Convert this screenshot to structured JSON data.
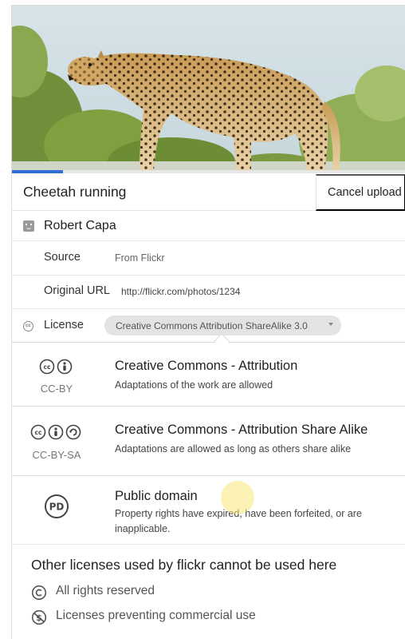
{
  "photo": {
    "title": "Cheetah running",
    "upload_progress_percent": 13
  },
  "header": {
    "cancel_label": "Cancel upload"
  },
  "author": {
    "name": "Robert Capa",
    "icon": "avatar-icon"
  },
  "fields": {
    "source_label": "Source",
    "source_value": "From Flickr",
    "url_label": "Original URL",
    "url_value": "http://flickr.com/photos/1234"
  },
  "license": {
    "icon": "cc-icon",
    "label": "License",
    "selected": "Creative Commons Attribution ShareAlike 3.0",
    "options": [
      {
        "title": "Creative Commons - Attribution",
        "description": "Adaptations of the work are allowed",
        "code": "CC-BY",
        "icons": [
          "cc-icon",
          "attribution-icon"
        ]
      },
      {
        "title": "Creative Commons - Attribution Share Alike",
        "description": "Adaptations are allowed as long as others share alike",
        "code": "CC-BY-SA",
        "icons": [
          "cc-icon",
          "attribution-icon",
          "share-alike-icon"
        ]
      },
      {
        "title": "Public domain",
        "description": "Property rights have expired, have been forfeited, or are inapplicable.",
        "code": "",
        "icons": [
          "public-domain-icon"
        ]
      }
    ]
  },
  "restricted": {
    "title": "Other licenses used by flickr cannot be used here",
    "items": [
      {
        "label": "All rights reserved",
        "icon": "copyright-icon"
      },
      {
        "label": "Licenses preventing commercial use",
        "icon": "non-commercial-icon"
      }
    ]
  },
  "colors": {
    "progress": "#2f6fd6",
    "select_bg": "#e3e3e3",
    "hover_highlight": "#fae878"
  }
}
